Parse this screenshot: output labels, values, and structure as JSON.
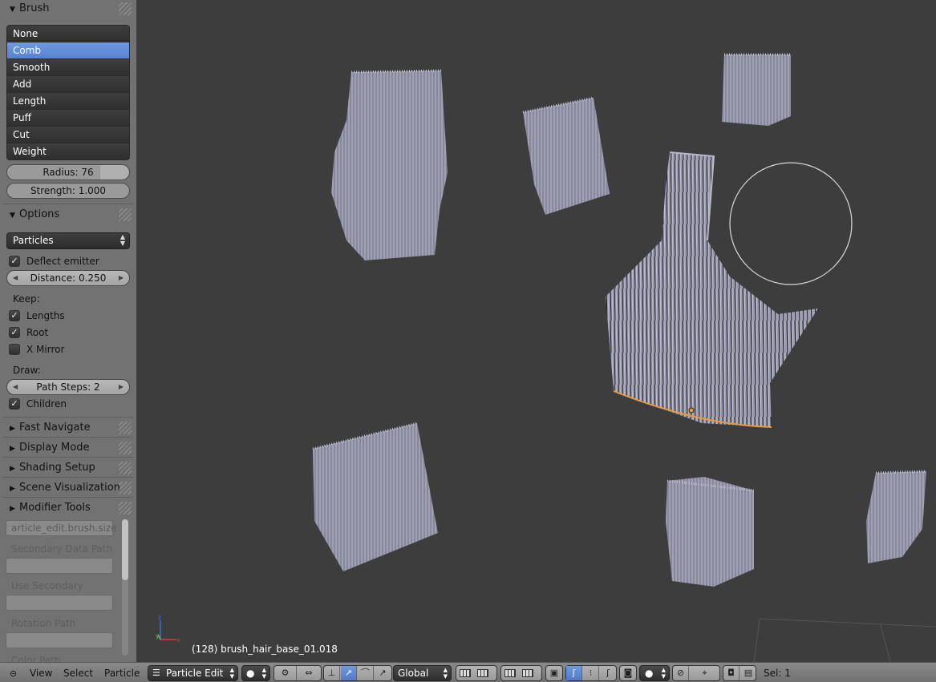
{
  "shelf": {
    "brush_panel": {
      "title": "Brush",
      "items": [
        {
          "label": "None",
          "active": false
        },
        {
          "label": "Comb",
          "active": true
        },
        {
          "label": "Smooth",
          "active": false
        },
        {
          "label": "Add",
          "active": false
        },
        {
          "label": "Length",
          "active": false
        },
        {
          "label": "Puff",
          "active": false
        },
        {
          "label": "Cut",
          "active": false
        },
        {
          "label": "Weight",
          "active": false
        }
      ],
      "radius_label": "Radius: 76",
      "radius_fraction": 0.76,
      "strength_label": "Strength: 1.000"
    },
    "options_panel": {
      "title": "Options",
      "mode_select": "Particles",
      "deflect_emitter_label": "Deflect emitter",
      "deflect_emitter_checked": true,
      "distance_label": "Distance: 0.250",
      "keep_label": "Keep:",
      "lengths_label": "Lengths",
      "lengths_checked": true,
      "root_label": "Root",
      "root_checked": true,
      "xmirror_label": "X Mirror",
      "xmirror_checked": false,
      "draw_label": "Draw:",
      "path_steps_label": "Path Steps: 2",
      "children_label": "Children",
      "children_checked": true
    },
    "collapsed_panels": [
      "Fast Navigate",
      "Display Mode",
      "Shading Setup",
      "Scene Visualization",
      "Modifier Tools"
    ],
    "modifier_tools": {
      "data_path_value": "article_edit.brush.size",
      "secondary_data_path_label": "Secondary Data Path",
      "use_secondary_label": "Use Secondary",
      "rotation_path_label": "Rotation Path",
      "color_path_label": "Color Path"
    }
  },
  "viewport": {
    "object_label": "(128) brush_hair_base_01.018"
  },
  "header": {
    "view_menu": "View",
    "select_menu": "Select",
    "particle_menu": "Particle",
    "mode": "Particle Edit",
    "orientation": "Global",
    "selection_count": "Sel: 1"
  },
  "colors": {
    "shelf_bg": "#727272",
    "viewport_bg": "#3d3d3d",
    "active_item": "#5783cf",
    "hair": "#9b9bb0",
    "selection_outline": "#e89a3c"
  }
}
